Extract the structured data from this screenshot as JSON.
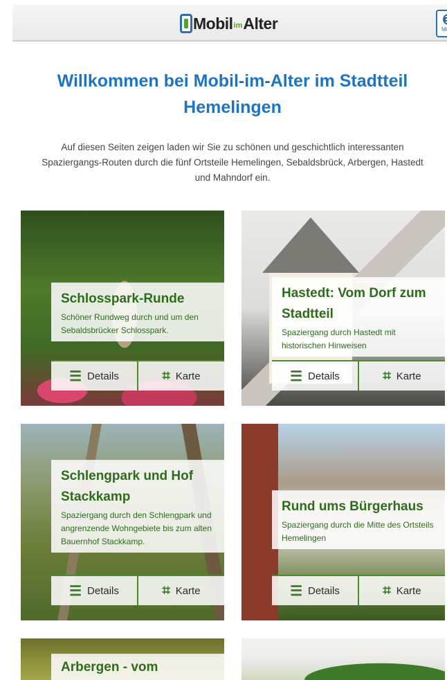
{
  "header": {
    "logo": {
      "part1": "Mobil",
      "part2": "im",
      "part3": "Alter"
    },
    "menu_label": "Menu"
  },
  "welcome_title": "Willkommen bei Mobil-im-Alter im Stadtteil Hemelingen",
  "intro_text": "Auf diesen Seiten zeigen laden wir Sie zu schönen und geschichtlich interessanten Spaziergangs-Routen durch die fünf Ortsteile Hemelingen, Sebaldsbrück, Arbergen, Hastedt und Mahndorf ein.",
  "actions": {
    "details": "Details",
    "karte": "Karte"
  },
  "cards": [
    {
      "title": "Schlosspark-Runde",
      "desc": "Schöner Rundweg durch und um den Sebaldsbrücker Schlosspark."
    },
    {
      "title": "Hastedt: Vom Dorf zum Stadtteil",
      "desc": "Spaziergang durch Hastedt mit historischen Hinweisen"
    },
    {
      "title": "Schlengpark und Hof Stackkamp",
      "desc": "Spaziergang durch den Schlengpark und angrenzende Wohngebiete bis zum alten Bauernhof Stackkamp."
    },
    {
      "title": "Rund ums Bürgerhaus",
      "desc": "Spaziergang durch die Mitte des Ortsteils Hemelingen"
    },
    {
      "title": "Arbergen - vom"
    }
  ]
}
